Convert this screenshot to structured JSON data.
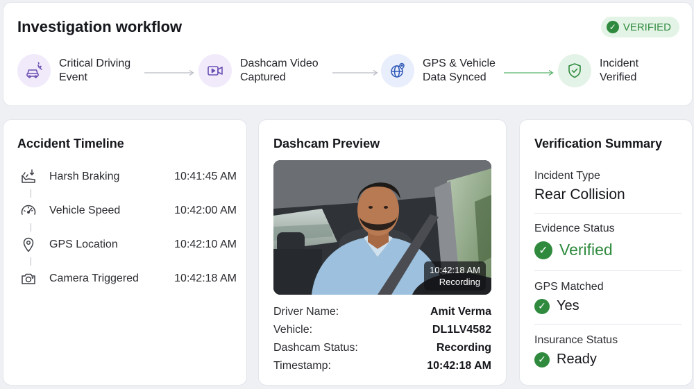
{
  "workflow": {
    "title": "Investigation workflow",
    "badge": "VERIFIED",
    "steps": [
      {
        "label": "Critical Driving\nEvent",
        "icon": "car-alert-icon"
      },
      {
        "label": "Dashcam Video\nCaptured",
        "icon": "video-camera-icon"
      },
      {
        "label": "GPS & Vehicle\nData Synced",
        "icon": "globe-pin-icon"
      },
      {
        "label": "Incident\nVerified",
        "icon": "shield-check-icon"
      }
    ]
  },
  "timeline": {
    "title": "Accident Timeline",
    "events": [
      {
        "name": "Harsh Braking",
        "time": "10:41:45 AM",
        "icon": "braking-icon"
      },
      {
        "name": "Vehicle Speed",
        "time": "10:42:00 AM",
        "icon": "speedometer-icon"
      },
      {
        "name": "GPS Location",
        "time": "10:42:10 AM",
        "icon": "location-pin-icon"
      },
      {
        "name": "Camera Triggered",
        "time": "10:42:18 AM",
        "icon": "camera-icon"
      }
    ]
  },
  "dashcam": {
    "title": "Dashcam Preview",
    "overlay_time": "10:42:18 AM",
    "overlay_status": "Recording",
    "fields": [
      {
        "key": "Driver Name:",
        "value": "Amit Verma"
      },
      {
        "key": "Vehicle:",
        "value": "DL1LV4582"
      },
      {
        "key": "Dashcam Status:",
        "value": "Recording"
      },
      {
        "key": "Timestamp:",
        "value": "10:42:18 AM"
      }
    ]
  },
  "verification": {
    "title": "Verification Summary",
    "incident_type_label": "Incident Type",
    "incident_type_value": "Rear Collision",
    "evidence_label": "Evidence Status",
    "evidence_value": "Verified",
    "gps_label": "GPS Matched",
    "gps_value": "Yes",
    "insurance_label": "Insurance Status",
    "insurance_value": "Ready"
  },
  "colors": {
    "accent_green": "#2f8a3e",
    "badge_bg": "#e3f4e6",
    "purple_circle": "#f1eafb",
    "blue_circle": "#e8eefb",
    "green_circle": "#e4f3e7"
  }
}
